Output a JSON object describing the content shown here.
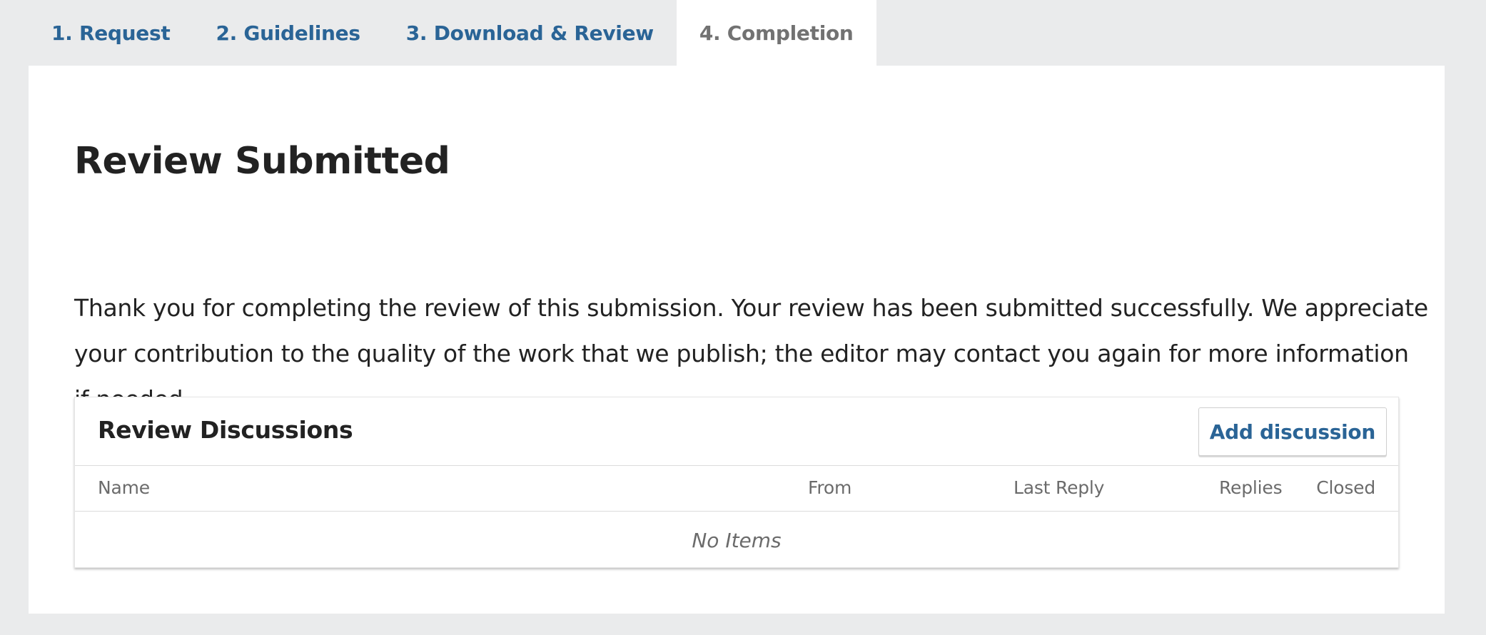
{
  "tabs": [
    {
      "label": "1. Request"
    },
    {
      "label": "2. Guidelines"
    },
    {
      "label": "3. Download & Review"
    },
    {
      "label": "4. Completion",
      "active": true
    }
  ],
  "page_title": "Review Submitted",
  "message": "Thank you for completing the review of this submission. Your review has been submitted successfully. We appreciate your contribution to the quality of the work that we publish; the editor may contact you again for more information if needed.",
  "discussions": {
    "title": "Review Discussions",
    "add_button": "Add discussion",
    "columns": [
      "Name",
      "From",
      "Last Reply",
      "Replies",
      "Closed"
    ],
    "rows": [],
    "empty_text": "No Items"
  },
  "colors": {
    "link": "#2a6496",
    "active_tab_text": "#727272",
    "background": "#eaebec",
    "panel": "#ffffff"
  }
}
